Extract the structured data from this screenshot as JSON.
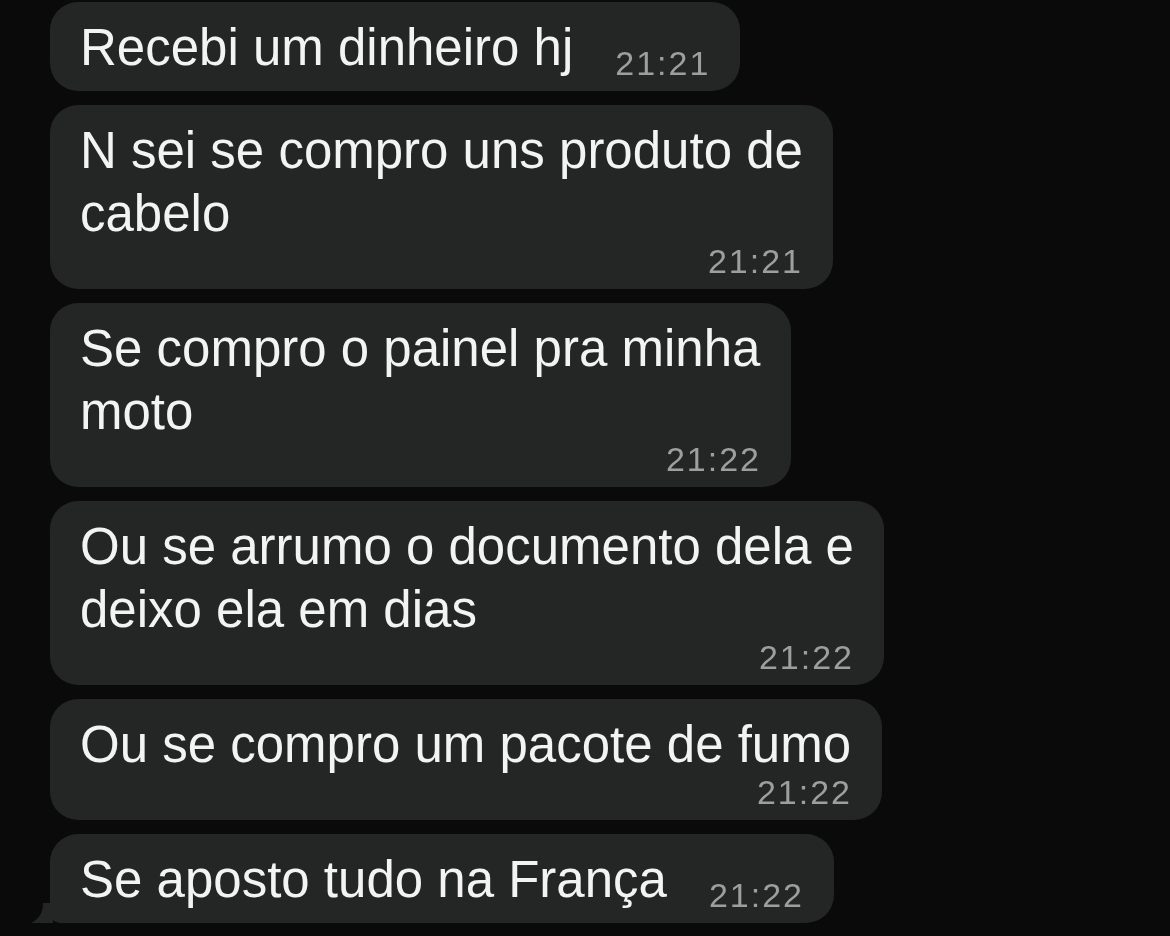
{
  "messages": [
    {
      "text": "Recebi um dinheiro hj",
      "time": "21:21",
      "tail": false
    },
    {
      "text": "N sei se compro uns produto de\ncabelo",
      "time": "21:21",
      "tail": false
    },
    {
      "text": "Se compro o painel pra minha\nmoto",
      "time": "21:22",
      "tail": false
    },
    {
      "text": "Ou se arrumo o documento dela e\ndeixo ela em dias",
      "time": "21:22",
      "tail": false
    },
    {
      "text": "Ou se compro um pacote de fumo",
      "time": "21:22",
      "tail": false
    },
    {
      "text": "Se aposto tudo na França",
      "time": "21:22",
      "tail": true
    }
  ]
}
